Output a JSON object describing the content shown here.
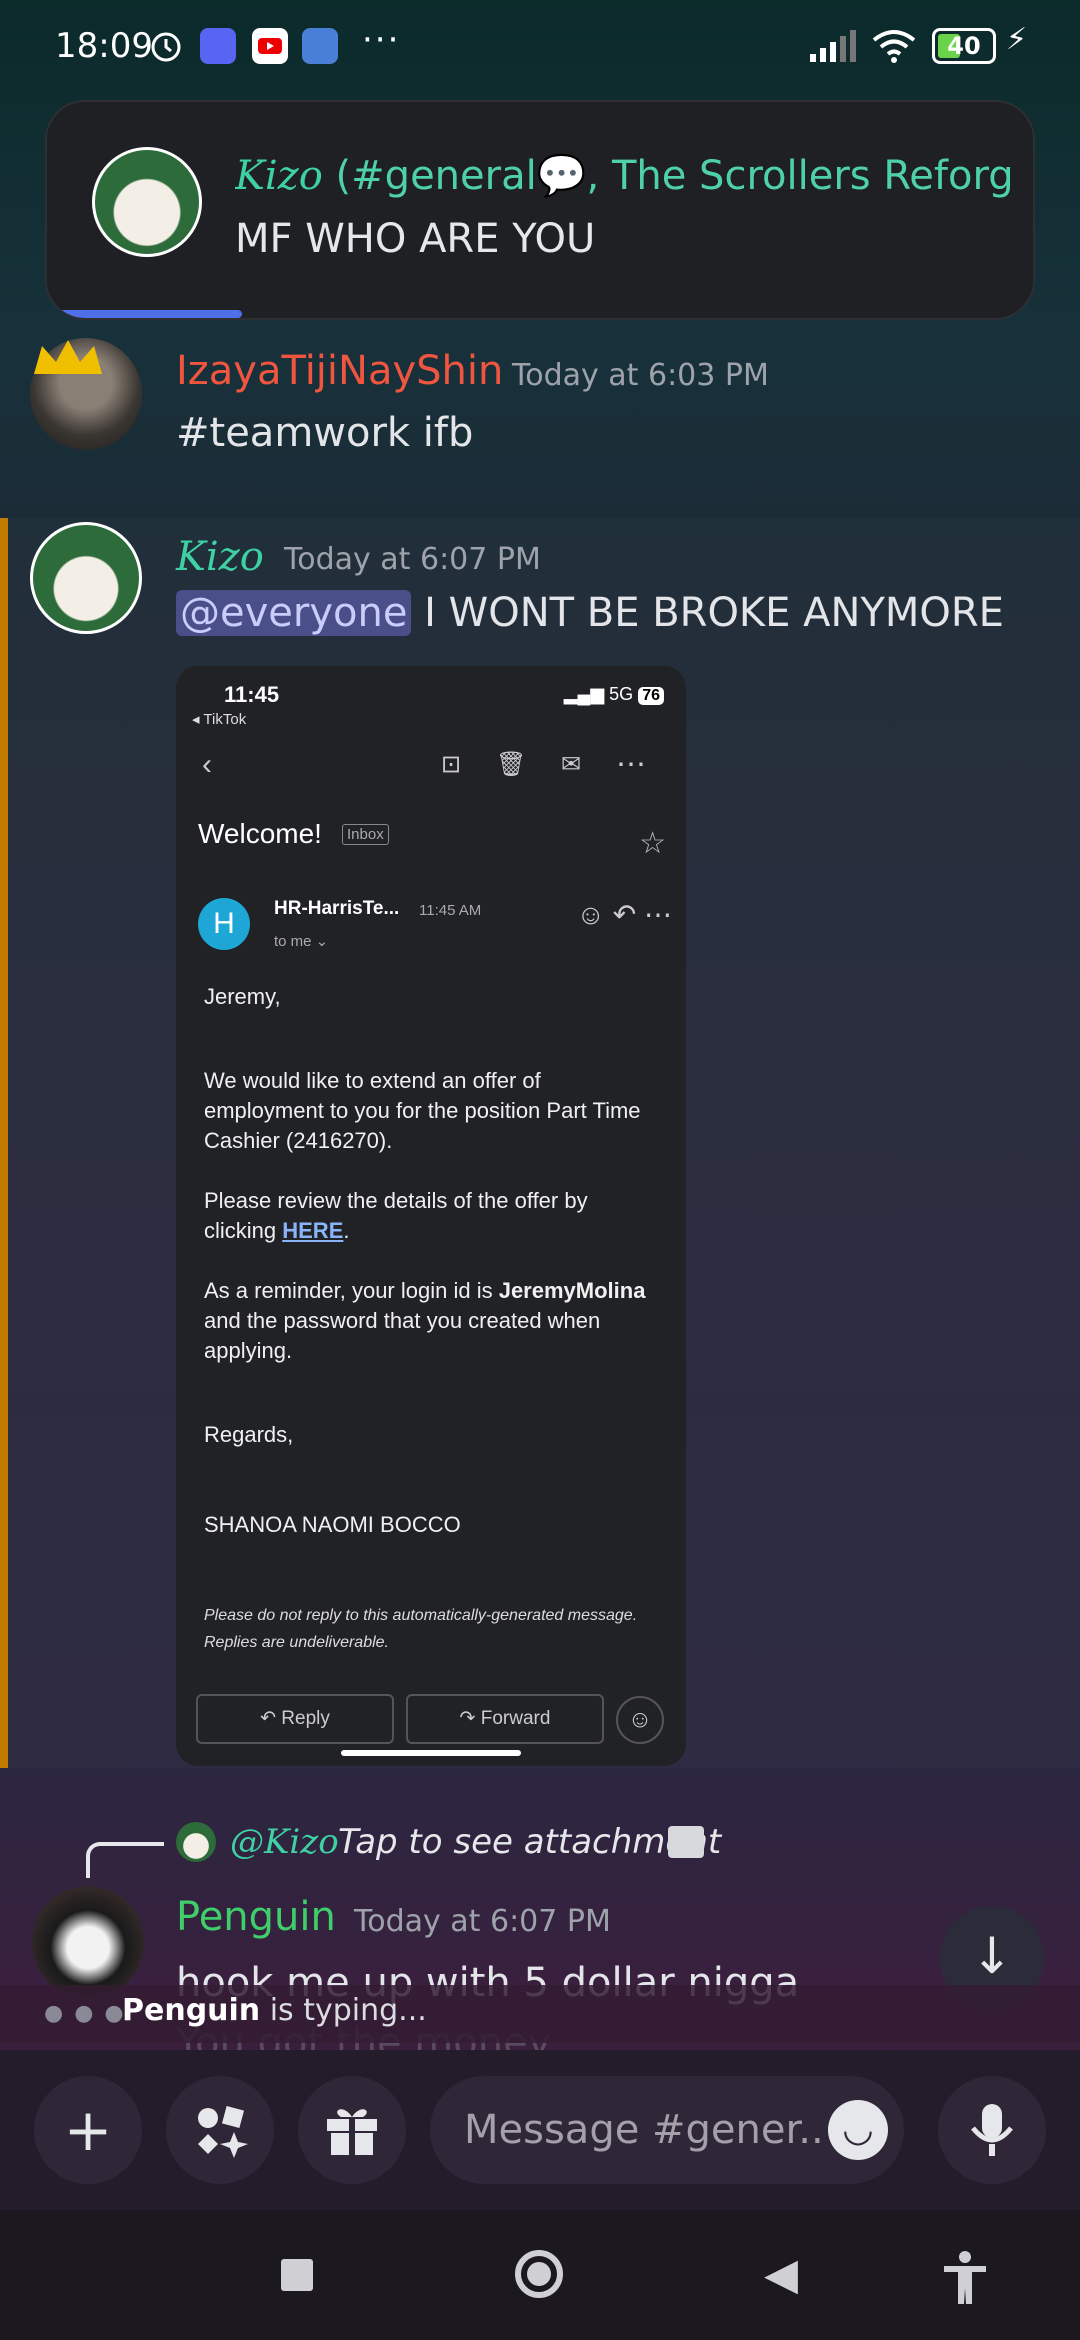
{
  "status_bar": {
    "time": "18:09",
    "more": "···",
    "battery": "40",
    "icons": [
      "alarm-icon",
      "discord-icon",
      "youtube-icon",
      "app-icon",
      "signal-icon",
      "wifi-icon",
      "battery-icon",
      "charging-icon"
    ]
  },
  "notification": {
    "sender": "Kizo",
    "title_rest": " (#general💬, The Scrollers Reforg...",
    "body": "MF WHO ARE YOU"
  },
  "messages": [
    {
      "username": "IzayaTijiNayShin",
      "username_color": "#f0553f",
      "timestamp": "Today at 6:03 PM",
      "text": "#teamwork ifb"
    },
    {
      "username": "Kizo",
      "username_color": "#3fd0a4",
      "timestamp": "Today at 6:07 PM",
      "mention": "@everyone",
      "text": " I WONT BE BROKE ANYMORE"
    }
  ],
  "attachment": {
    "phone_time": "11:45",
    "back_app": "◂ TikTok",
    "network": "5G",
    "battery": "76",
    "subject": "Welcome!",
    "inbox_label": "Inbox",
    "avatar_letter": "H",
    "sender": "HR-HarrisTe...",
    "sent_time": "11:45 AM",
    "to": "to me ⌄",
    "greeting": "Jeremy,",
    "para1": "We would like to extend an offer of employment to you for the position Part Time Cashier (2416270).",
    "para2_pre": "Please review the details of the offer by clicking ",
    "para2_link": "HERE",
    "para2_post": ".",
    "para3_pre": "As a reminder, your login id is ",
    "para3_bold": "JeremyMolina",
    "para3_post": " and the password that you created when applying.",
    "regards": "Regards,",
    "signature": "SHANOA NAOMI BOCCO",
    "footer": "Please do not reply to this automatically-generated message. Replies are undeliverable.",
    "reply_button": "↶  Reply",
    "forward_button": "↷  Forward"
  },
  "reply_preview": {
    "name": "@Kizo",
    "text": "Tap to see attachment"
  },
  "penguin_message": {
    "username": "Penguin",
    "username_color": "#3ecf6b",
    "timestamp": "Today at 6:07 PM",
    "text": "hook me up with 5 dollar nigga",
    "next_text": "You got the money"
  },
  "typing": {
    "user": "Penguin",
    "text": " is typing..."
  },
  "composer": {
    "placeholder": "Message #gener..."
  }
}
